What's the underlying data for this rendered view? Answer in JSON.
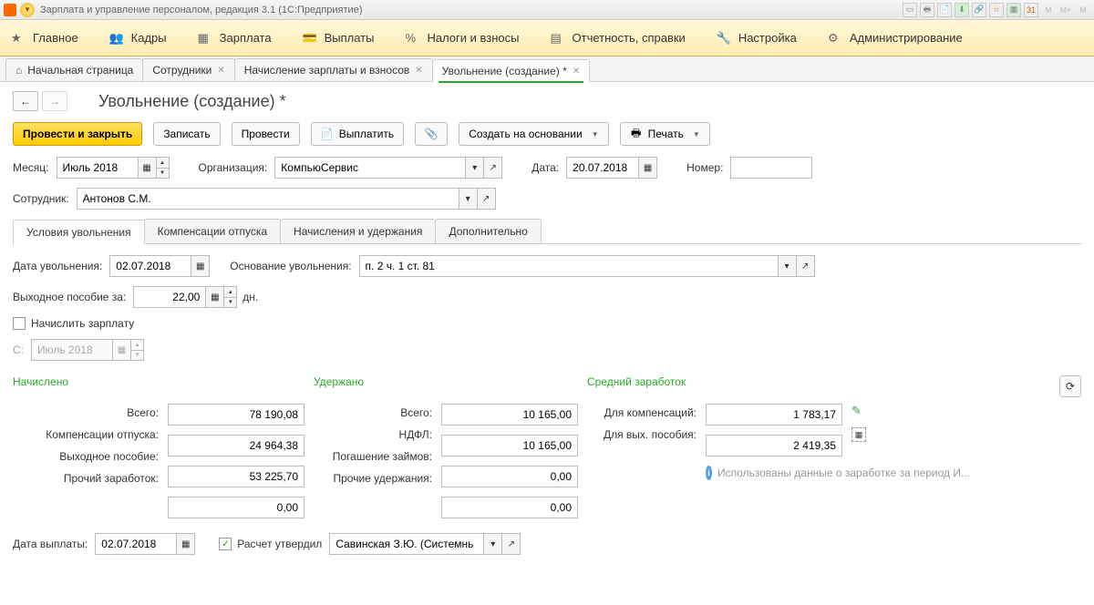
{
  "titlebar": {
    "text": "Зарплата и управление персоналом, редакция 3.1  (1С:Предприятие)",
    "sys_m1": "M",
    "sys_m2": "M+",
    "sys_m3": "M"
  },
  "mainmenu": {
    "items": [
      {
        "label": "Главное"
      },
      {
        "label": "Кадры"
      },
      {
        "label": "Зарплата"
      },
      {
        "label": "Выплаты"
      },
      {
        "label": "Налоги и взносы"
      },
      {
        "label": "Отчетность, справки"
      },
      {
        "label": "Настройка"
      },
      {
        "label": "Администрирование"
      }
    ]
  },
  "open_tabs": [
    {
      "label": "Начальная страница",
      "closable": false
    },
    {
      "label": "Сотрудники",
      "closable": true
    },
    {
      "label": "Начисление зарплаты и взносов",
      "closable": true
    },
    {
      "label": "Увольнение (создание) *",
      "closable": true,
      "active": true
    }
  ],
  "page_title": "Увольнение (создание) *",
  "toolbar": {
    "submit_close": "Провести и закрыть",
    "save": "Записать",
    "submit": "Провести",
    "pay": "Выплатить",
    "create_based": "Создать на основании",
    "print": "Печать"
  },
  "header_form": {
    "month_lbl": "Месяц:",
    "month_val": "Июль 2018",
    "org_lbl": "Организация:",
    "org_val": "КомпьюСервис",
    "date_lbl": "Дата:",
    "date_val": "20.07.2018",
    "number_lbl": "Номер:",
    "number_val": "",
    "employee_lbl": "Сотрудник:",
    "employee_val": "Антонов С.М."
  },
  "subtabs": [
    {
      "label": "Условия увольнения",
      "active": true
    },
    {
      "label": "Компенсации отпуска"
    },
    {
      "label": "Начисления и удержания"
    },
    {
      "label": "Дополнительно"
    }
  ],
  "conditions": {
    "dismiss_date_lbl": "Дата увольнения:",
    "dismiss_date_val": "02.07.2018",
    "reason_lbl": "Основание увольнения:",
    "reason_val": "п. 2 ч. 1 ст. 81",
    "severance_lbl": "Выходное пособие за:",
    "severance_val": "22,00",
    "severance_unit": "дн.",
    "accrue_salary_lbl": "Начислить зарплату",
    "from_lbl": "С:",
    "from_val": "Июль 2018"
  },
  "summary": {
    "accrued_hdr": "Начислено",
    "withheld_hdr": "Удержано",
    "avg_hdr": "Средний заработок",
    "total_lbl": "Всего:",
    "total_accrued": "78 190,08",
    "total_withheld": "10 165,00",
    "comp_vac_lbl": "Компенсации отпуска:",
    "comp_vac_val": "24 964,38",
    "ndfl_lbl": "НДФЛ:",
    "ndfl_val": "10 165,00",
    "severance_lbl": "Выходное пособие:",
    "severance_val": "53 225,70",
    "loan_lbl": "Погашение займов:",
    "loan_val": "0,00",
    "other_inc_lbl": "Прочий заработок:",
    "other_inc_val": "0,00",
    "other_ded_lbl": "Прочие удержания:",
    "other_ded_val": "0,00",
    "for_comp_lbl": "Для компенсаций:",
    "for_comp_val": "1 783,17",
    "for_sev_lbl": "Для вых. пособия:",
    "for_sev_val": "2 419,35",
    "info_text": "Использованы данные о заработке за период И..."
  },
  "footer": {
    "pay_date_lbl": "Дата выплаты:",
    "pay_date_val": "02.07.2018",
    "approved_lbl": "Расчет утвердил",
    "approved_val": "Савинская З.Ю. (Системнь"
  }
}
